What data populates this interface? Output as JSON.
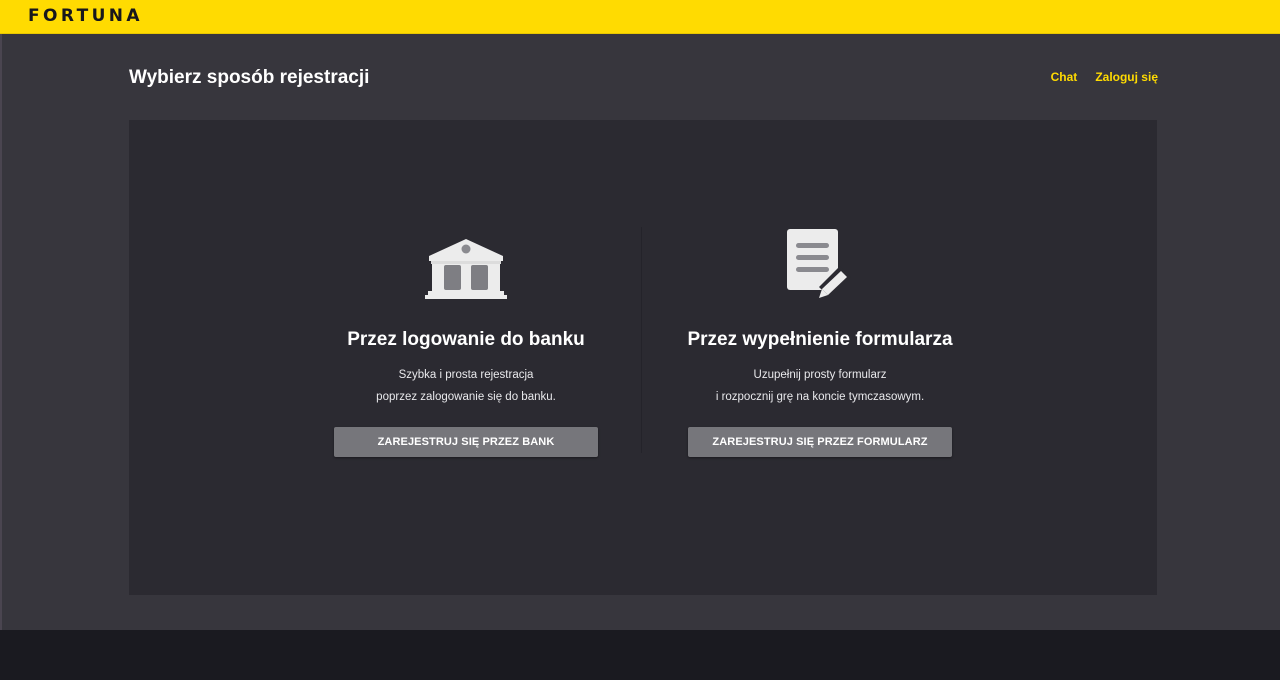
{
  "brand": {
    "logo_text": "FORTUNA",
    "accent_color": "#ffdb01"
  },
  "header": {
    "title": "Wybierz sposób rejestracji",
    "links": [
      {
        "label": "Chat"
      },
      {
        "label": "Zaloguj się"
      }
    ]
  },
  "options": [
    {
      "icon": "bank-icon",
      "title": "Przez logowanie do banku",
      "desc_line1": "Szybka i prosta rejestracja",
      "desc_line2": "poprzez zalogowanie się do banku.",
      "button_label": "ZAREJESTRUJ SIĘ PRZEZ BANK"
    },
    {
      "icon": "form-document-icon",
      "title": "Przez wypełnienie formularza",
      "desc_line1": "Uzupełnij prosty formularz",
      "desc_line2": "i rozpocznij grę na koncie tymczasowym.",
      "button_label": "ZAREJESTRUJ SIĘ PRZEZ FORMULARZ"
    }
  ],
  "colors": {
    "page_background": "#37363d",
    "card_background": "#2b2a31",
    "button_background": "#76767b",
    "footer_background": "#1a1a20"
  }
}
